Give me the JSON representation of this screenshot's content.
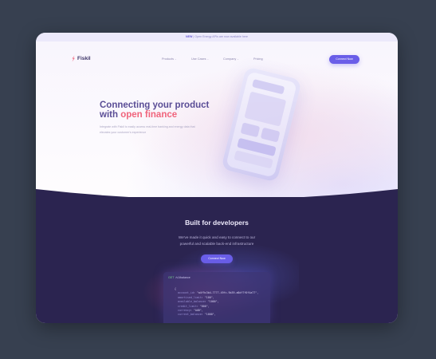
{
  "announcement": {
    "badge": "NEW",
    "text": "Open Energy APIs are now available here"
  },
  "header": {
    "brand": "Fiskil",
    "nav": [
      {
        "label": "Products",
        "has_menu": true
      },
      {
        "label": "Use Cases",
        "has_menu": true
      },
      {
        "label": "Company",
        "has_menu": true
      },
      {
        "label": "Pricing",
        "has_menu": false
      }
    ],
    "cta_label": "Connect Now"
  },
  "hero": {
    "title_line1": "Connecting your product",
    "title_line2_prefix": "with",
    "title_line2_accent": "open finance",
    "subtitle_line1": "Integrate with Fiskil to easily access real-time banking and energy data that",
    "subtitle_line2": "elevates your customer's experience"
  },
  "developers": {
    "title": "Built for developers",
    "subtitle_line1": "We've made it quick and easy to connect to our",
    "subtitle_line2": "powerful and scalable back-end infrastructure",
    "cta_label": "Connect Now",
    "code": {
      "method": "GET",
      "path": "/v1/balance",
      "open_brace": "{",
      "lines": [
        {
          "key": "account_id",
          "value": "\"a4f9c3b4-7777-49fc-9b39-a8df7f0f4a77\""
        },
        {
          "key": "amortised_limit",
          "value": "\"100\""
        },
        {
          "key": "available_balance",
          "value": "\"1000\""
        },
        {
          "key": "credit_limit",
          "value": "\"800\""
        },
        {
          "key": "currency",
          "value": "\"AUD\""
        },
        {
          "key": "current_balance",
          "value": "\"1000\""
        }
      ]
    }
  },
  "colors": {
    "accent": "#6a5ee8",
    "highlight": "#f0647c",
    "dark_section": "#2b2450"
  }
}
